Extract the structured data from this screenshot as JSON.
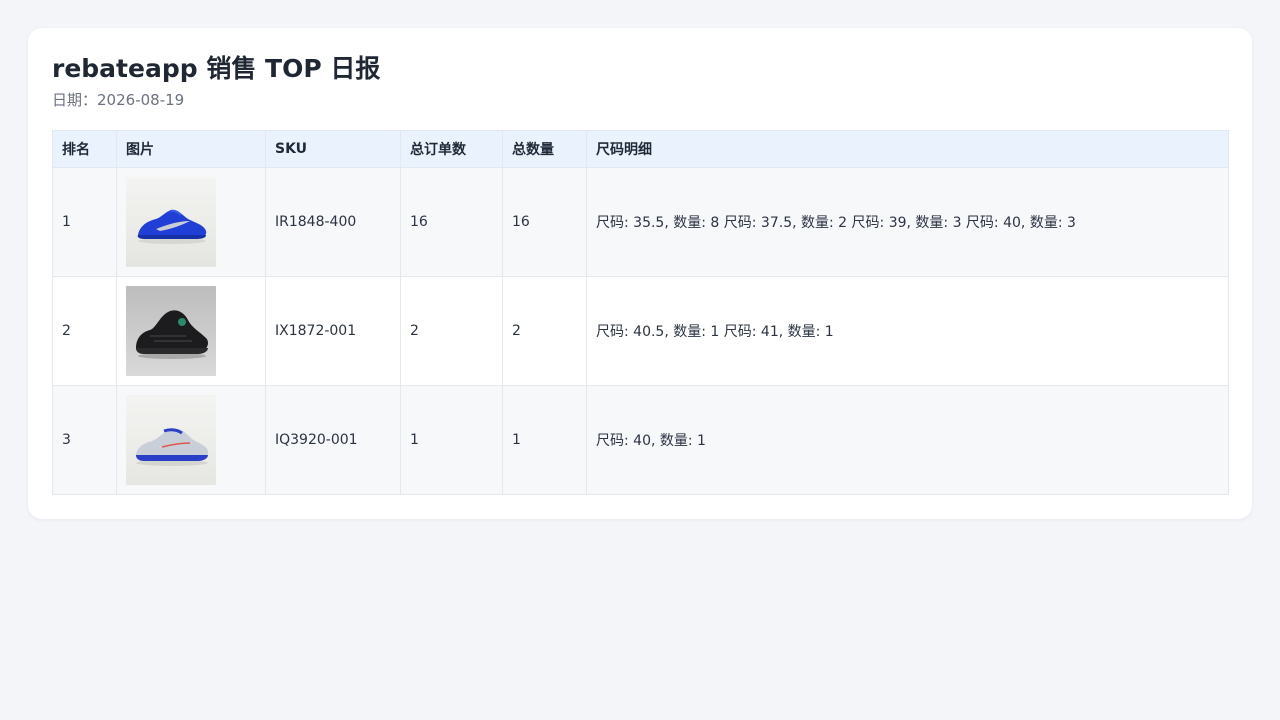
{
  "header": {
    "title": "rebateapp 销售 TOP 日报",
    "date_label": "日期：",
    "date_value": "2026-08-19"
  },
  "table": {
    "columns": [
      "排名",
      "图片",
      "SKU",
      "总订单数",
      "总数量",
      "尺码明细"
    ],
    "rows": [
      {
        "rank": "1",
        "image": "blue-sneaker-image",
        "sku": "IR1848-400",
        "orders": "16",
        "quantity": "16",
        "sizes": "尺码: 35.5, 数量: 8 尺码: 37.5, 数量: 2 尺码: 39, 数量: 3 尺码: 40, 数量: 3"
      },
      {
        "rank": "2",
        "image": "black-sneaker-image",
        "sku": "IX1872-001",
        "orders": "2",
        "quantity": "2",
        "sizes": "尺码: 40.5, 数量: 1 尺码: 41, 数量: 1"
      },
      {
        "rank": "3",
        "image": "white-blue-sneaker-image",
        "sku": "IQ3920-001",
        "orders": "1",
        "quantity": "1",
        "sizes": "尺码: 40, 数量: 1"
      }
    ]
  },
  "colors": {
    "page_background": "#f3f5f9",
    "card_background": "#ffffff",
    "header_row": "#eaf2fe",
    "row_striped": "#f7f8fa",
    "border": "#e3e8ef"
  }
}
